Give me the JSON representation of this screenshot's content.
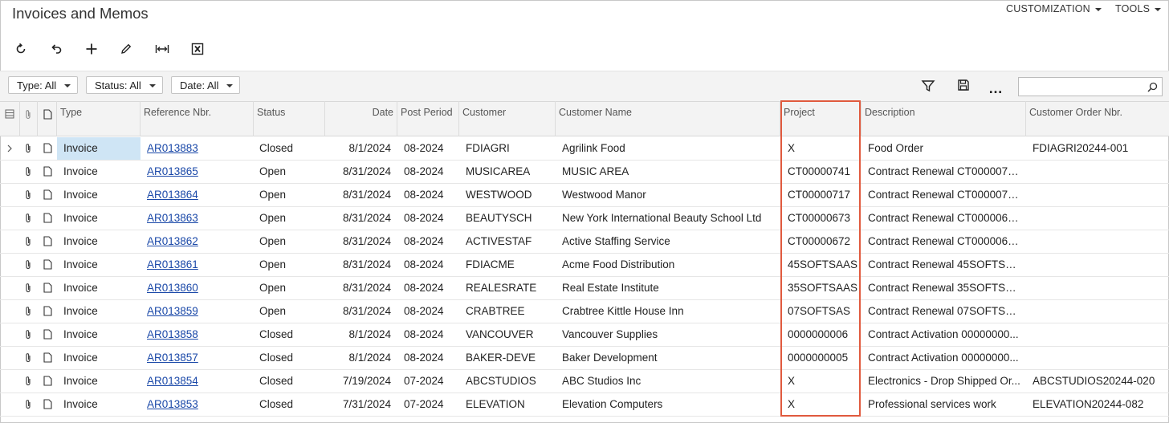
{
  "page": {
    "title": "Invoices and Memos"
  },
  "top_menu": {
    "customization": "CUSTOMIZATION",
    "tools": "TOOLS"
  },
  "toolbar": {
    "icons": [
      "refresh-icon",
      "undo-icon",
      "add-icon",
      "edit-icon",
      "fit-columns-icon",
      "excel-icon"
    ]
  },
  "filters": {
    "type": "Type: All",
    "status": "Status: All",
    "date": "Date: All"
  },
  "search": {
    "placeholder": ""
  },
  "columns": {
    "type": "Type",
    "ref": "Reference Nbr.",
    "status": "Status",
    "date": "Date",
    "post_period": "Post Period",
    "customer": "Customer",
    "customer_name": "Customer Name",
    "project": "Project",
    "description": "Description",
    "customer_order": "Customer Order Nbr."
  },
  "rows": [
    {
      "type": "Invoice",
      "ref": "AR013883",
      "status": "Closed",
      "date": "8/1/2024",
      "period": "08-2024",
      "customer": "FDIAGRI",
      "name": "Agrilink Food",
      "project": "X",
      "description": "Food Order",
      "order": "FDIAGRI20244-001"
    },
    {
      "type": "Invoice",
      "ref": "AR013865",
      "status": "Open",
      "date": "8/31/2024",
      "period": "08-2024",
      "customer": "MUSICAREA",
      "name": "MUSIC AREA",
      "project": "CT00000741",
      "description": "Contract Renewal CT0000074...",
      "order": ""
    },
    {
      "type": "Invoice",
      "ref": "AR013864",
      "status": "Open",
      "date": "8/31/2024",
      "period": "08-2024",
      "customer": "WESTWOOD",
      "name": "Westwood Manor",
      "project": "CT00000717",
      "description": "Contract Renewal CT0000071...",
      "order": ""
    },
    {
      "type": "Invoice",
      "ref": "AR013863",
      "status": "Open",
      "date": "8/31/2024",
      "period": "08-2024",
      "customer": "BEAUTYSCH",
      "name": "New York International Beauty School Ltd",
      "project": "CT00000673",
      "description": "Contract Renewal CT0000067...",
      "order": ""
    },
    {
      "type": "Invoice",
      "ref": "AR013862",
      "status": "Open",
      "date": "8/31/2024",
      "period": "08-2024",
      "customer": "ACTIVESTAF",
      "name": "Active Staffing Service",
      "project": "CT00000672",
      "description": "Contract Renewal CT0000067...",
      "order": ""
    },
    {
      "type": "Invoice",
      "ref": "AR013861",
      "status": "Open",
      "date": "8/31/2024",
      "period": "08-2024",
      "customer": "FDIACME",
      "name": "Acme Food Distribution",
      "project": "45SOFTSAAS",
      "description": "Contract Renewal 45SOFTSA...",
      "order": ""
    },
    {
      "type": "Invoice",
      "ref": "AR013860",
      "status": "Open",
      "date": "8/31/2024",
      "period": "08-2024",
      "customer": "REALESRATE",
      "name": "Real Estate Institute",
      "project": "35SOFTSAAS",
      "description": "Contract Renewal 35SOFTSA...",
      "order": ""
    },
    {
      "type": "Invoice",
      "ref": "AR013859",
      "status": "Open",
      "date": "8/31/2024",
      "period": "08-2024",
      "customer": "CRABTREE",
      "name": "Crabtree Kittle House Inn",
      "project": "07SOFTSAS",
      "description": "Contract Renewal 07SOFTSA...",
      "order": ""
    },
    {
      "type": "Invoice",
      "ref": "AR013858",
      "status": "Closed",
      "date": "8/1/2024",
      "period": "08-2024",
      "customer": "VANCOUVER",
      "name": "Vancouver Supplies",
      "project": "0000000006",
      "description": "Contract Activation 00000000...",
      "order": ""
    },
    {
      "type": "Invoice",
      "ref": "AR013857",
      "status": "Closed",
      "date": "8/1/2024",
      "period": "08-2024",
      "customer": "BAKER-DEVE",
      "name": "Baker Development",
      "project": "0000000005",
      "description": "Contract Activation 00000000...",
      "order": ""
    },
    {
      "type": "Invoice",
      "ref": "AR013854",
      "status": "Closed",
      "date": "7/19/2024",
      "period": "07-2024",
      "customer": "ABCSTUDIOS",
      "name": "ABC Studios Inc",
      "project": "X",
      "description": "Electronics - Drop Shipped Or...",
      "order": "ABCSTUDIOS20244-020"
    },
    {
      "type": "Invoice",
      "ref": "AR013853",
      "status": "Closed",
      "date": "7/31/2024",
      "period": "07-2024",
      "customer": "ELEVATION",
      "name": "Elevation Computers",
      "project": "X",
      "description": "Professional services work",
      "order": "ELEVATION20244-082"
    }
  ],
  "colors": {
    "link": "#1a48a8",
    "selected_row": "#cfe5f5",
    "highlight_box": "#e05a3e",
    "header_bg": "#f3f3f3"
  }
}
